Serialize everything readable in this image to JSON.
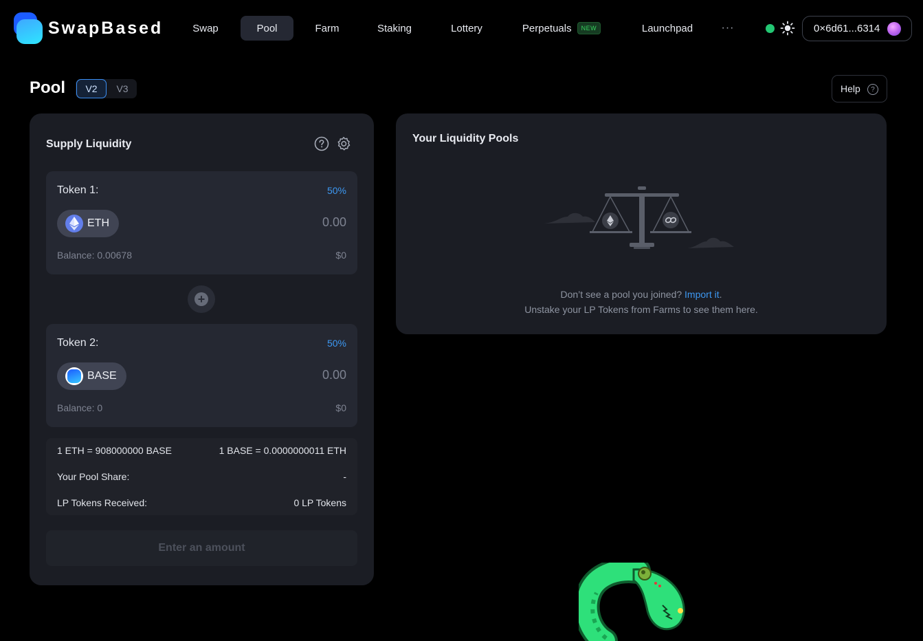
{
  "brand": {
    "name": "SwapBased"
  },
  "nav": {
    "items": [
      {
        "label": "Swap"
      },
      {
        "label": "Pool"
      },
      {
        "label": "Farm"
      },
      {
        "label": "Staking"
      },
      {
        "label": "Lottery"
      },
      {
        "label": "Perpetuals",
        "badge": "NEW"
      },
      {
        "label": "Launchpad"
      }
    ],
    "active": "Pool",
    "more_label": "···"
  },
  "wallet": {
    "address": "0×6d61...6314"
  },
  "colors": {
    "accent": "#3d98f2",
    "status": "#23c773",
    "badge_new": "#37d45f"
  },
  "page": {
    "title": "Pool",
    "versions": [
      "V2",
      "V3"
    ],
    "active_version": "V2",
    "help_label": "Help"
  },
  "supply": {
    "title": "Supply Liquidity",
    "token1": {
      "label": "Token 1:",
      "percent": "50%",
      "symbol": "ETH",
      "amount": "0.00",
      "balance": "Balance: 0.00678",
      "usd": "$0"
    },
    "token2": {
      "label": "Token 2:",
      "percent": "50%",
      "symbol": "BASE",
      "amount": "0.00",
      "balance": "Balance: 0",
      "usd": "$0"
    },
    "rate_left": "1 ETH = 908000000 BASE",
    "rate_right": "1 BASE = 0.0000000011 ETH",
    "pool_share_label": "Your Pool Share:",
    "pool_share_value": "-",
    "lp_label": "LP Tokens Received:",
    "lp_value": "0 LP Tokens",
    "cta_label": "Enter an amount"
  },
  "pools": {
    "title": "Your Liquidity Pools",
    "empty_text": "Don’t see a pool you joined?",
    "import_link": "Import it",
    "import_suffix": ".",
    "unstake_text": "Unstake your LP Tokens from Farms to see them here."
  },
  "icons": [
    "sun-icon",
    "help-circle-icon",
    "gear-icon",
    "plus-icon",
    "eth-icon",
    "base-icon",
    "scale-icon",
    "snake-mascot-icon"
  ]
}
